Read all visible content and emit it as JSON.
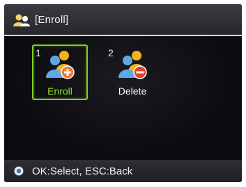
{
  "header": {
    "title": "[Enroll]",
    "icon": "users-icon"
  },
  "menu": {
    "items": [
      {
        "number": "1",
        "label": "Enroll",
        "icon": "add-user-icon",
        "selected": true
      },
      {
        "number": "2",
        "label": "Delete",
        "icon": "remove-user-icon",
        "selected": false
      }
    ]
  },
  "footer": {
    "hint": "OK:Select, ESC:Back",
    "icon": "info-icon"
  },
  "colors": {
    "selection": "#7ed321",
    "background": "#0b0b0f",
    "user_icon_yellow": "#f2b21b",
    "user_icon_blue": "#5fa8e6",
    "add_badge": "#f07b2a",
    "remove_badge": "#e2442a"
  }
}
